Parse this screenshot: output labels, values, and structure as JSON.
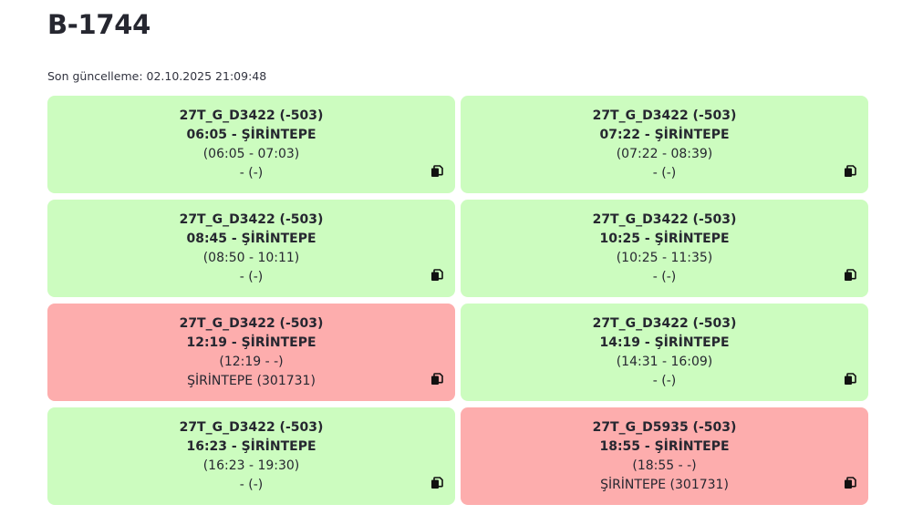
{
  "title": "B-1744",
  "last_updated_label": "Son güncelleme: 02.10.2025 21:09:48",
  "cards": [
    {
      "route": "27T_G_D3422 (-503)",
      "departure": "06:05 - ŞİRİNTEPE",
      "times": "(06:05 - 07:03)",
      "stop": "- (-)",
      "status": "green",
      "copy_icon": "copy-icon"
    },
    {
      "route": "27T_G_D3422 (-503)",
      "departure": "07:22 - ŞİRİNTEPE",
      "times": "(07:22 - 08:39)",
      "stop": "- (-)",
      "status": "green",
      "copy_icon": "copy-icon"
    },
    {
      "route": "27T_G_D3422 (-503)",
      "departure": "08:45 - ŞİRİNTEPE",
      "times": "(08:50 - 10:11)",
      "stop": "- (-)",
      "status": "green",
      "copy_icon": "copy-icon"
    },
    {
      "route": "27T_G_D3422 (-503)",
      "departure": "10:25 - ŞİRİNTEPE",
      "times": "(10:25 - 11:35)",
      "stop": "- (-)",
      "status": "green",
      "copy_icon": "copy-icon"
    },
    {
      "route": "27T_G_D3422 (-503)",
      "departure": "12:19 - ŞİRİNTEPE",
      "times": "(12:19 - -)",
      "stop": "ŞİRİNTEPE (301731)",
      "status": "red",
      "copy_icon": "copy-icon"
    },
    {
      "route": "27T_G_D3422 (-503)",
      "departure": "14:19 - ŞİRİNTEPE",
      "times": "(14:31 - 16:09)",
      "stop": "- (-)",
      "status": "green",
      "copy_icon": "copy-icon"
    },
    {
      "route": "27T_G_D3422 (-503)",
      "departure": "16:23 - ŞİRİNTEPE",
      "times": "(16:23 - 19:30)",
      "stop": "- (-)",
      "status": "green",
      "copy_icon": "copy-icon"
    },
    {
      "route": "27T_G_D5935 (-503)",
      "departure": "18:55 - ŞİRİNTEPE",
      "times": "(18:55 - -)",
      "stop": "ŞİRİNTEPE (301731)",
      "status": "red",
      "copy_icon": "copy-icon"
    }
  ],
  "colors": {
    "green": "#ccfcbf",
    "red": "#fdadad",
    "text": "#262730"
  }
}
